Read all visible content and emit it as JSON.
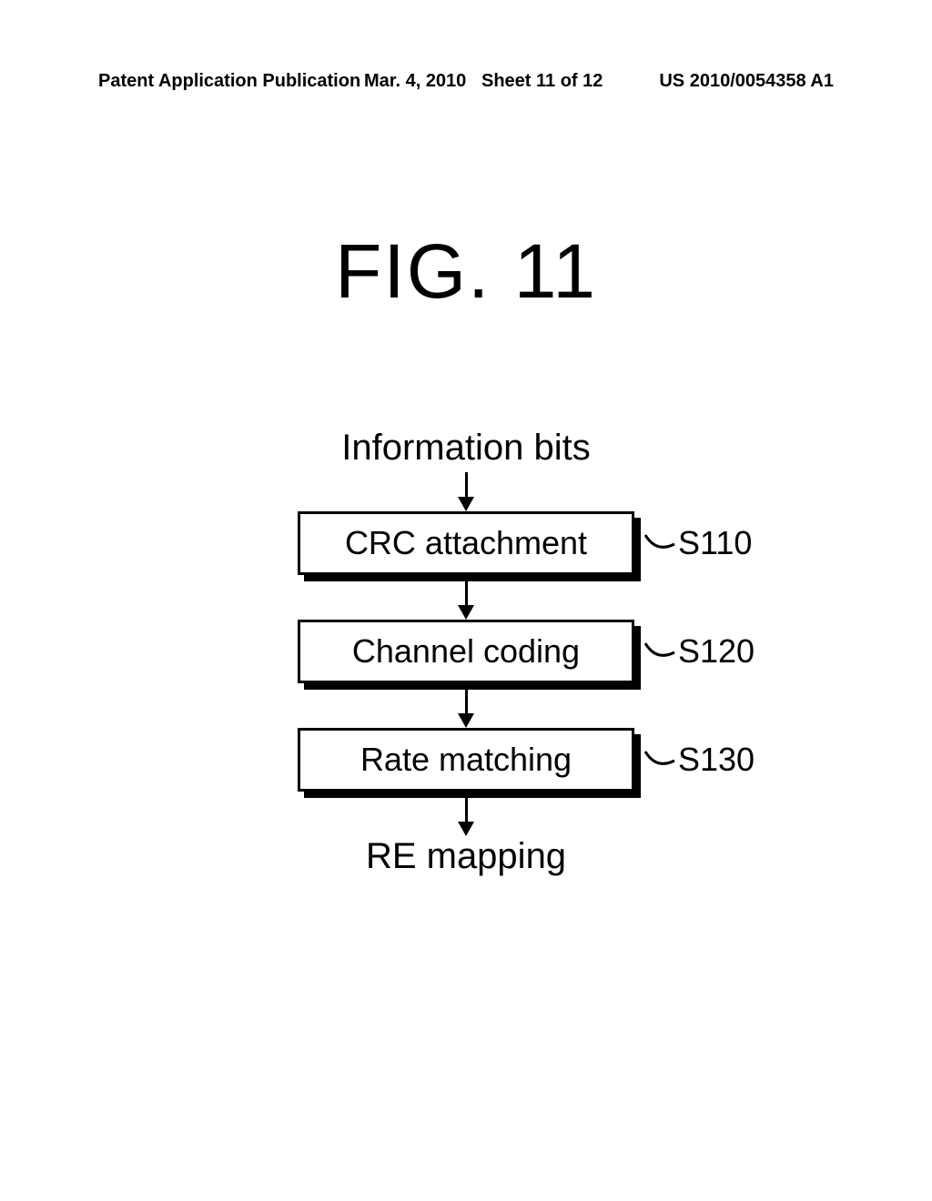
{
  "header": {
    "left": "Patent Application Publication",
    "mid_date": "Mar. 4, 2010",
    "mid_sheet": "Sheet 11 of 12",
    "right": "US 2010/0054358 A1"
  },
  "figure": {
    "title": "FIG. 11",
    "input_label": "Information bits",
    "output_label": "RE mapping",
    "steps": [
      {
        "text": "CRC attachment",
        "tag": "S110"
      },
      {
        "text": "Channel coding",
        "tag": "S120"
      },
      {
        "text": "Rate matching",
        "tag": "S130"
      }
    ]
  }
}
